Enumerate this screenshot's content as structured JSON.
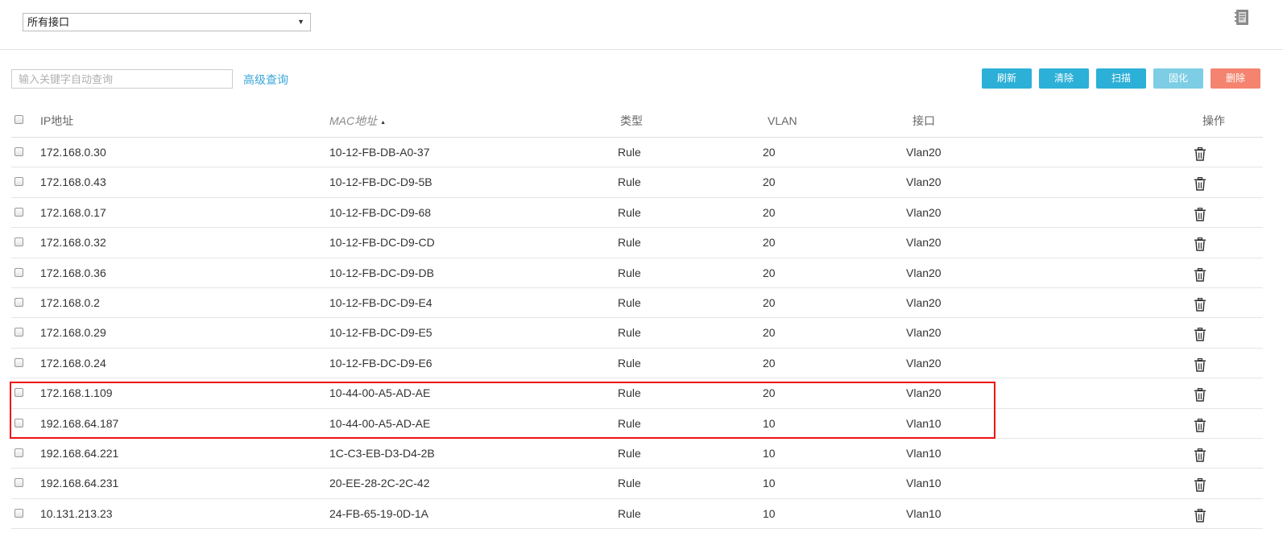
{
  "toolbar": {
    "interface_filter": "所有接口",
    "search_placeholder": "输入关键字自动查询",
    "advanced_search": "高级查询",
    "buttons": {
      "refresh": "刷新",
      "clear": "清除",
      "scan": "扫描",
      "bind": "固化",
      "delete": "删除"
    }
  },
  "table": {
    "headers": {
      "ip": "IP地址",
      "mac": "MAC地址",
      "type": "类型",
      "vlan": "VLAN",
      "interface": "接口",
      "action": "操作"
    },
    "sort": {
      "column": "mac",
      "direction": "ascending"
    },
    "rows": [
      {
        "ip": "172.168.0.30",
        "mac": "10-12-FB-DB-A0-37",
        "type": "Rule",
        "vlan": "20",
        "interface": "Vlan20"
      },
      {
        "ip": "172.168.0.43",
        "mac": "10-12-FB-DC-D9-5B",
        "type": "Rule",
        "vlan": "20",
        "interface": "Vlan20"
      },
      {
        "ip": "172.168.0.17",
        "mac": "10-12-FB-DC-D9-68",
        "type": "Rule",
        "vlan": "20",
        "interface": "Vlan20"
      },
      {
        "ip": "172.168.0.32",
        "mac": "10-12-FB-DC-D9-CD",
        "type": "Rule",
        "vlan": "20",
        "interface": "Vlan20"
      },
      {
        "ip": "172.168.0.36",
        "mac": "10-12-FB-DC-D9-DB",
        "type": "Rule",
        "vlan": "20",
        "interface": "Vlan20"
      },
      {
        "ip": "172.168.0.2",
        "mac": "10-12-FB-DC-D9-E4",
        "type": "Rule",
        "vlan": "20",
        "interface": "Vlan20"
      },
      {
        "ip": "172.168.0.29",
        "mac": "10-12-FB-DC-D9-E5",
        "type": "Rule",
        "vlan": "20",
        "interface": "Vlan20"
      },
      {
        "ip": "172.168.0.24",
        "mac": "10-12-FB-DC-D9-E6",
        "type": "Rule",
        "vlan": "20",
        "interface": "Vlan20"
      },
      {
        "ip": "172.168.1.109",
        "mac": "10-44-00-A5-AD-AE",
        "type": "Rule",
        "vlan": "20",
        "interface": "Vlan20"
      },
      {
        "ip": "192.168.64.187",
        "mac": "10-44-00-A5-AD-AE",
        "type": "Rule",
        "vlan": "10",
        "interface": "Vlan10"
      },
      {
        "ip": "192.168.64.221",
        "mac": "1C-C3-EB-D3-D4-2B",
        "type": "Rule",
        "vlan": "10",
        "interface": "Vlan10"
      },
      {
        "ip": "192.168.64.231",
        "mac": "20-EE-28-2C-2C-42",
        "type": "Rule",
        "vlan": "10",
        "interface": "Vlan10"
      },
      {
        "ip": "10.131.213.23",
        "mac": "24-FB-65-19-0D-1A",
        "type": "Rule",
        "vlan": "10",
        "interface": "Vlan10"
      }
    ]
  },
  "icons": {
    "top_right": "notebook-icon",
    "row_action": "trash-icon",
    "sort": "sort-ascending-icon"
  },
  "colors": {
    "primary_button": "#2cb0d7",
    "disabled_button": "#7dcde5",
    "danger_button": "#f4846f",
    "link": "#3aa6d8",
    "highlight_box": "#ee1111"
  }
}
